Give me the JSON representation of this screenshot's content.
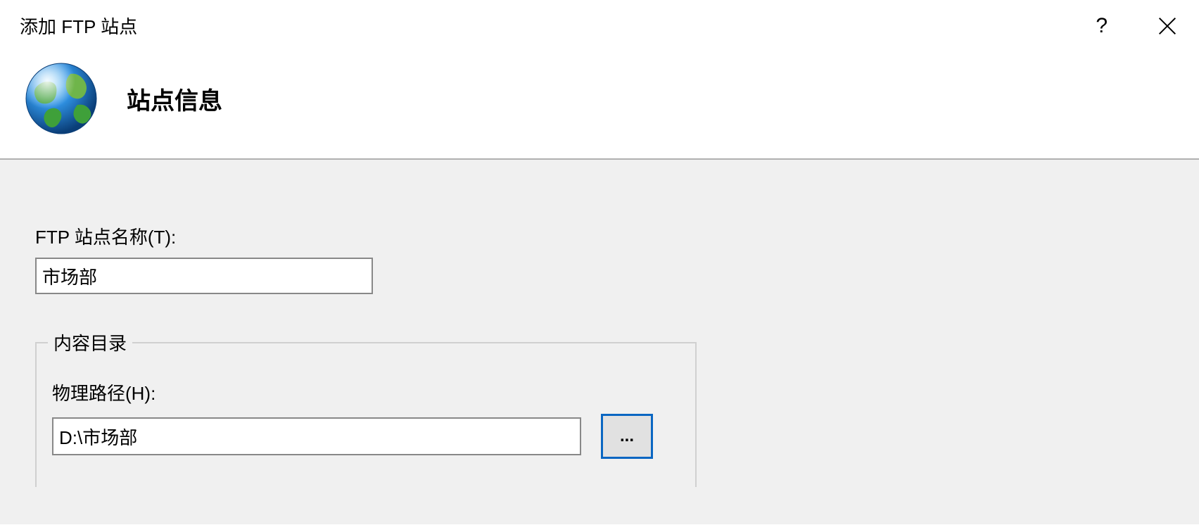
{
  "window": {
    "title": "添加 FTP 站点"
  },
  "header": {
    "heading": "站点信息"
  },
  "form": {
    "site_name_label": "FTP 站点名称(T):",
    "site_name_value": "市场部",
    "content_dir_legend": "内容目录",
    "physical_path_label": "物理路径(H):",
    "physical_path_value": "D:\\市场部",
    "browse_button_label": "..."
  }
}
